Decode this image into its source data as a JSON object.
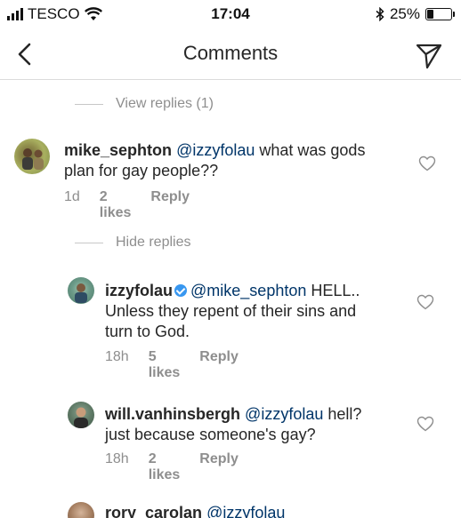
{
  "status": {
    "carrier": "TESCO",
    "time": "17:04",
    "battery": "25%",
    "battery_level": 0.25
  },
  "nav": {
    "title": "Comments"
  },
  "links": {
    "view_replies": "View replies (1)",
    "hide_replies": "Hide replies"
  },
  "comments": [
    {
      "username": "mike_sephton",
      "mention": "@izzyfolau",
      "text_line1": " what was gods",
      "text_line2": "plan for gay people??",
      "age": "1d",
      "likes": "2 likes",
      "reply": "Reply"
    },
    {
      "username": "izzyfolau",
      "verified": true,
      "mention": "@mike_sephton",
      "text_line1": " HELL..",
      "text_line2": "Unless they repent of their sins and",
      "text_line3": "turn to God.",
      "age": "18h",
      "likes": "5 likes",
      "reply": "Reply"
    },
    {
      "username": "will.vanhinsbergh",
      "mention": "@izzyfolau",
      "text_line1": " hell?",
      "text_line2": "just because someone's gay?",
      "age": "18h",
      "likes": "2 likes",
      "reply": "Reply"
    },
    {
      "username": "rory_carolan",
      "mention": "@izzyfolau"
    }
  ]
}
